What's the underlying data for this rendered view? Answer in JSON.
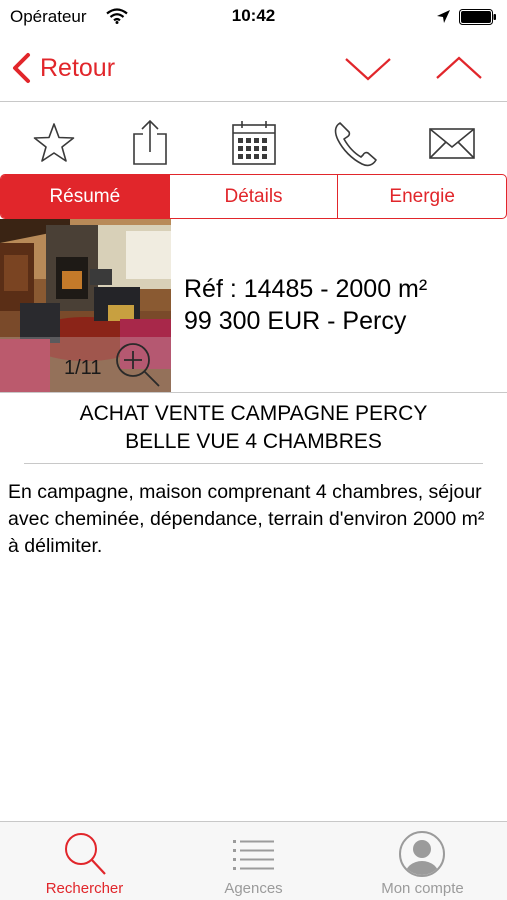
{
  "status_bar": {
    "carrier": "Opérateur",
    "time": "10:42"
  },
  "nav": {
    "back_label": "Retour"
  },
  "segments": [
    {
      "label": "Résumé",
      "active": true
    },
    {
      "label": "Détails",
      "active": false
    },
    {
      "label": "Energie",
      "active": false
    }
  ],
  "listing": {
    "photo_counter": "1/11",
    "ref_line": "Réf : 14485 - 2000 m²",
    "price_line": "99 300  EUR - Percy",
    "title_line1": "ACHAT VENTE CAMPAGNE PERCY",
    "title_line2": "BELLE VUE 4 CHAMBRES",
    "description": "En campagne, maison comprenant 4 chambres, séjour avec cheminée, dépendance, terrain d'environ 2000 m² à délimiter."
  },
  "tab_bar": {
    "tabs": [
      {
        "label": "Rechercher",
        "icon": "search-icon",
        "active": true
      },
      {
        "label": "Agences",
        "icon": "list-icon",
        "active": false
      },
      {
        "label": "Mon compte",
        "icon": "account-icon",
        "active": false
      }
    ]
  },
  "colors": {
    "accent": "#e1262b",
    "inactive_tab": "#9b9b9b"
  }
}
